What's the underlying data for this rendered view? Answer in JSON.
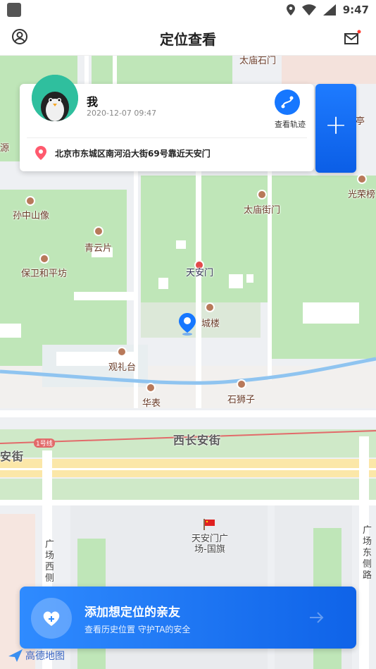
{
  "status_bar": {
    "time": "9:47"
  },
  "navbar": {
    "title": "定位查看"
  },
  "user_card": {
    "name": "我",
    "timestamp": "2020-12-07 09:47",
    "track_label": "查看轨迹",
    "address": "北京市东城区南河沿大街69号靠近天安门"
  },
  "map": {
    "labels": {
      "taimiao_top": "太庙石门",
      "ting": "亭",
      "yuan": "源",
      "guangrongbang": "光荣榜",
      "sunzhongshan": "孙中山像",
      "taimiao_gate": "太庙街门",
      "qingyunpian": "青云片",
      "baowei": "保卫和平坊",
      "tiananmen": "天安门",
      "chenglou": "城楼",
      "guanlitai": "观礼台",
      "huabiao": "华表",
      "shishizi": "石狮子",
      "xichangan": "西长安街",
      "anjie": "安街",
      "line1": "1号线",
      "square_flag": "天安门广场-国旗",
      "west_side": "广场西侧",
      "east_road": "广场东侧路"
    },
    "provider": "高德地图"
  },
  "banner": {
    "title": "添加想定位的亲友",
    "subtitle": "查看历史位置 守护TA的安全"
  },
  "colors": {
    "accent": "#1677ff",
    "map_green": "#bfe6b8",
    "map_road": "#ffffff",
    "river": "#8fc4f0"
  }
}
